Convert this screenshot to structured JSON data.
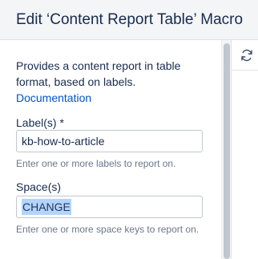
{
  "dialog": {
    "title": "Edit ‘Content Report Table’ Macro"
  },
  "form": {
    "description": "Provides a content report in table format, based on labels.",
    "documentation_link": "Documentation",
    "labels": {
      "label": "Label(s) *",
      "value": "kb-how-to-article",
      "helper": "Enter one or more labels to report on."
    },
    "spaces": {
      "label": "Space(s)",
      "value": "CHANGE",
      "helper": "Enter one or more space keys to report on."
    }
  },
  "preview": {
    "refresh_icon": "refresh-icon"
  }
}
